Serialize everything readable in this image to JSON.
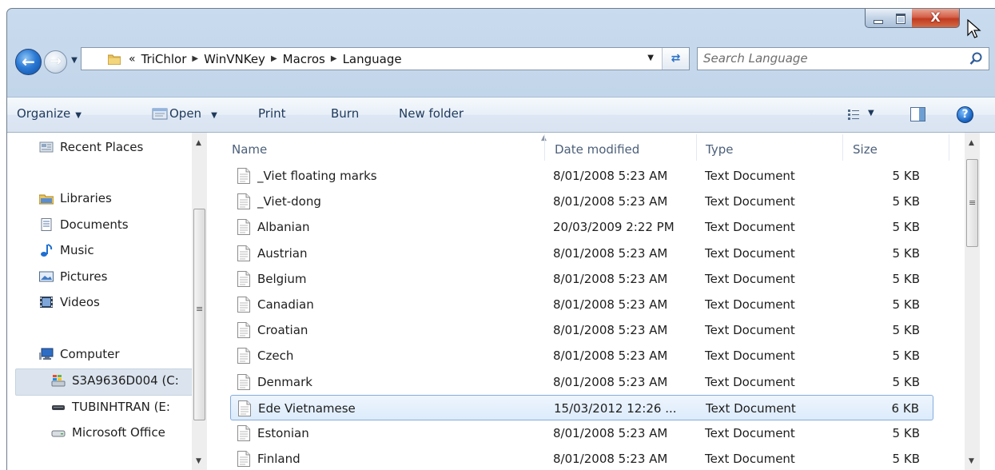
{
  "window": {
    "close_glyph": "X"
  },
  "address_bar": {
    "overflow": "«",
    "crumbs": [
      "TriChlor",
      "WinVNKey",
      "Macros",
      "Language"
    ]
  },
  "search": {
    "placeholder": "Search Language"
  },
  "toolbar": {
    "organize": "Organize",
    "open": "Open",
    "print": "Print",
    "burn": "Burn",
    "new_folder": "New folder",
    "help": "?"
  },
  "nav": {
    "recent_places": "Recent Places",
    "libraries": "Libraries",
    "documents": "Documents",
    "music": "Music",
    "pictures": "Pictures",
    "videos": "Videos",
    "computer": "Computer",
    "drive_c": "S3A9636D004 (C:",
    "drive_e": "TUBINHTRAN (E:",
    "microsoft_office": "Microsoft Office"
  },
  "columns": {
    "name": "Name",
    "date": "Date modified",
    "type": "Type",
    "size": "Size"
  },
  "files": [
    {
      "name": "_Viet floating marks",
      "date": "8/01/2008 5:23 AM",
      "type": "Text Document",
      "size": "5 KB"
    },
    {
      "name": "_Viet-dong",
      "date": "8/01/2008 5:23 AM",
      "type": "Text Document",
      "size": "5 KB"
    },
    {
      "name": "Albanian",
      "date": "20/03/2009 2:22 PM",
      "type": "Text Document",
      "size": "5 KB"
    },
    {
      "name": "Austrian",
      "date": "8/01/2008 5:23 AM",
      "type": "Text Document",
      "size": "5 KB"
    },
    {
      "name": "Belgium",
      "date": "8/01/2008 5:23 AM",
      "type": "Text Document",
      "size": "5 KB"
    },
    {
      "name": "Canadian",
      "date": "8/01/2008 5:23 AM",
      "type": "Text Document",
      "size": "5 KB"
    },
    {
      "name": "Croatian",
      "date": "8/01/2008 5:23 AM",
      "type": "Text Document",
      "size": "5 KB"
    },
    {
      "name": "Czech",
      "date": "8/01/2008 5:23 AM",
      "type": "Text Document",
      "size": "5 KB"
    },
    {
      "name": "Denmark",
      "date": "8/01/2008 5:23 AM",
      "type": "Text Document",
      "size": "5 KB"
    },
    {
      "name": "Ede Vietnamese",
      "date": "15/03/2012 12:26 ...",
      "type": "Text Document",
      "size": "6 KB"
    },
    {
      "name": "Estonian",
      "date": "8/01/2008 5:23 AM",
      "type": "Text Document",
      "size": "5 KB"
    },
    {
      "name": "Finland",
      "date": "8/01/2008 5:23 AM",
      "type": "Text Document",
      "size": "5 KB"
    }
  ]
}
